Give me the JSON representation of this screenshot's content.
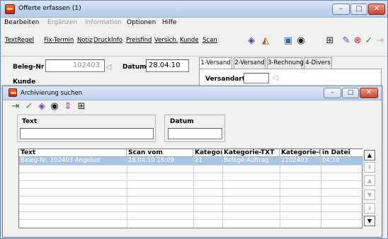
{
  "window": {
    "title": "Offerte erfassen (1)",
    "minimize_label": "–",
    "maximize_label": "□",
    "close_label": "✕"
  },
  "menu": [
    {
      "label": "Bearbeiten",
      "enabled": true
    },
    {
      "label": "Ergänzen",
      "enabled": false
    },
    {
      "label": "Information",
      "enabled": false
    },
    {
      "label": "Optionen",
      "enabled": true
    },
    {
      "label": "Hilfe",
      "enabled": true
    }
  ],
  "toolbar": {
    "links": [
      "TextRegel",
      "Fix-Termin",
      "Notiz",
      "DruckInfo",
      "Preisfind",
      "Versich.",
      "Kunde",
      "Scan"
    ],
    "icons": [
      "eraser-icon",
      "pizza-icon",
      "image-icon",
      "target-icon",
      "binoculars-icon",
      "eraser2-icon",
      "cancel-icon",
      "checkmark-icon",
      "exit-icon"
    ],
    "glyphs": [
      "◈",
      "◭",
      "▣",
      "◉",
      "⊞",
      "✎",
      "⊗",
      "✓",
      "⇥"
    ]
  },
  "form": {
    "beleg_label": "Beleg-Nr",
    "beleg_value": "102403",
    "datum_label": "Datum",
    "datum_value": "28.04.10",
    "kunde_label": "Kunde"
  },
  "tabs": [
    "1-Versand",
    "2-Versand",
    "3-Rechnung",
    "4-Divers"
  ],
  "tab_panel": {
    "versandart_label": "Versandart",
    "versandart_value": ""
  },
  "dialog": {
    "title": "Archivierung suchen",
    "toolbar_icons": [
      "exit-icon",
      "checkmark-icon",
      "eraser-icon",
      "target-icon",
      "sort-icon",
      "binoculars-icon"
    ],
    "toolbar_glyphs": [
      "⇥",
      "✓",
      "◈",
      "◉",
      "⇕",
      "⊞"
    ],
    "text_label": "Text",
    "text_value": "",
    "datum_label": "Datum",
    "datum_value": "",
    "grid": {
      "columns": [
        "Text",
        "Scan vom",
        "Kategor",
        "Kategorie-TXT",
        "Kategorie-N",
        "in Datei"
      ],
      "rows": [
        [
          "Beleg-Nr. 102403 Angebot",
          "28.04.10 16:09",
          "21",
          "Belege Auftrag",
          "1102403",
          "04:10"
        ]
      ],
      "empty_rows": 7
    },
    "scroll": {
      "top": "▲",
      "pageup": "⇞",
      "up": "▲",
      "down": "▼",
      "pagedown": "⇟",
      "bottom": "▼"
    }
  },
  "colors": {
    "title_bar": "#c3d6ef",
    "selected_row": "#a9c5e6",
    "close_button": "#c9452d"
  }
}
